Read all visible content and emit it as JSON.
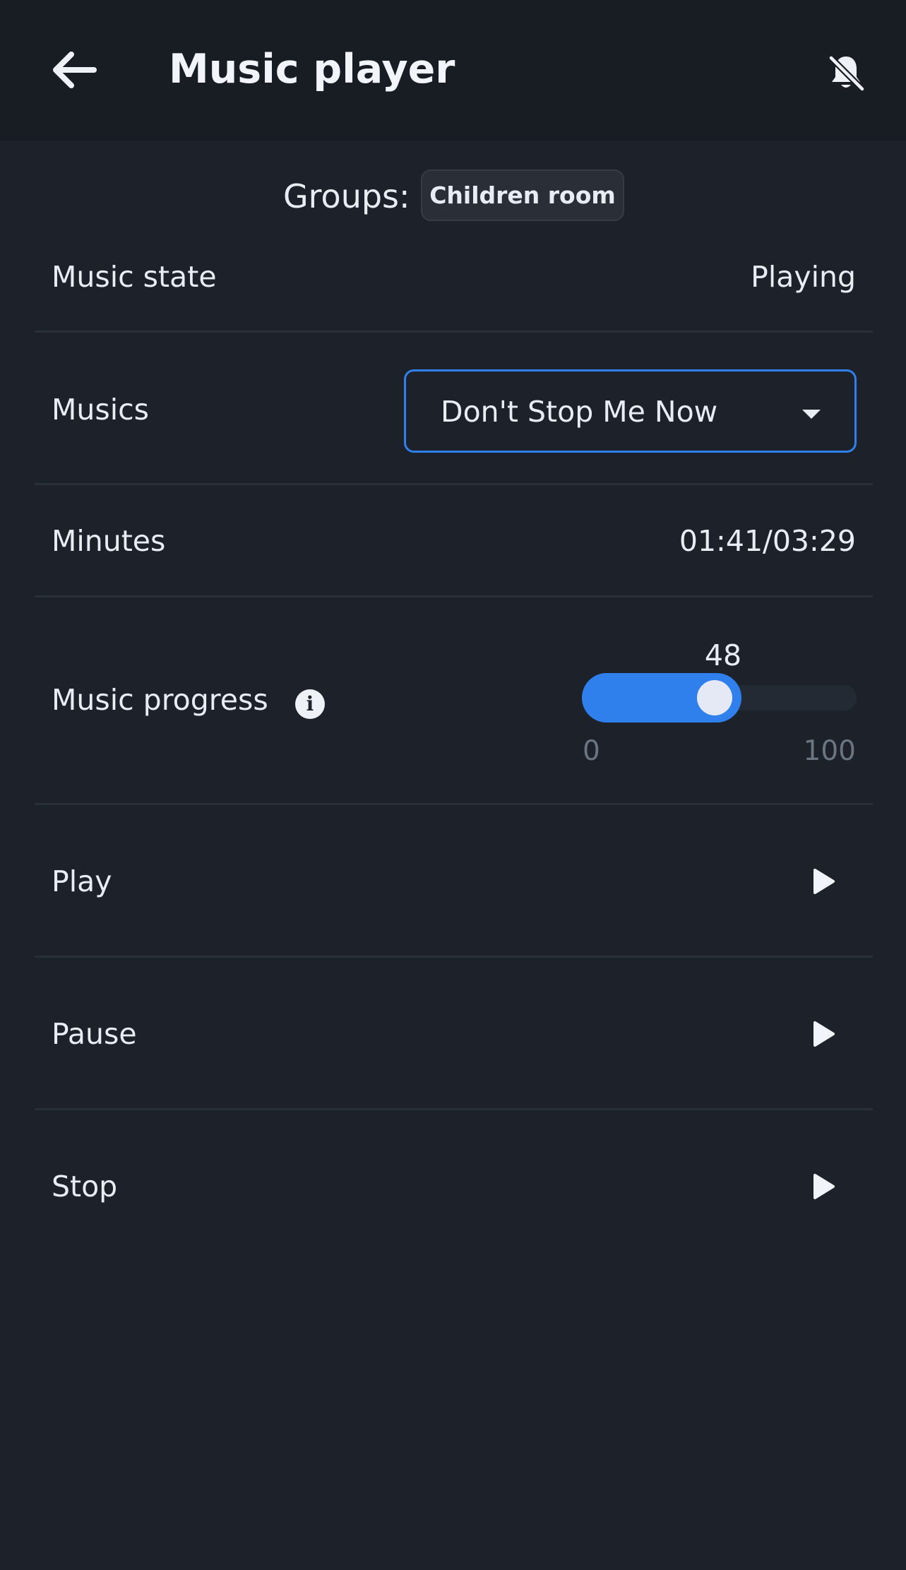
{
  "header": {
    "title": "Music player",
    "back_icon": "arrow-left-icon",
    "bell_icon": "bell-off-icon"
  },
  "groups": {
    "label": "Groups:",
    "items": [
      "Children room"
    ]
  },
  "music_state": {
    "label": "Music state",
    "value": "Playing"
  },
  "musics": {
    "label": "Musics",
    "selected": "Don't Stop Me Now"
  },
  "minutes": {
    "label": "Minutes",
    "value": "01:41/03:29"
  },
  "progress": {
    "label": "Music progress",
    "value": 48,
    "min": 0,
    "max": 100,
    "info_icon": "info-icon"
  },
  "actions": [
    {
      "label": "Play",
      "icon": "play-icon"
    },
    {
      "label": "Pause",
      "icon": "play-icon"
    },
    {
      "label": "Stop",
      "icon": "play-icon"
    }
  ],
  "colors": {
    "accent": "#2f80ed",
    "background": "#1d222a",
    "header": "#181c23"
  }
}
